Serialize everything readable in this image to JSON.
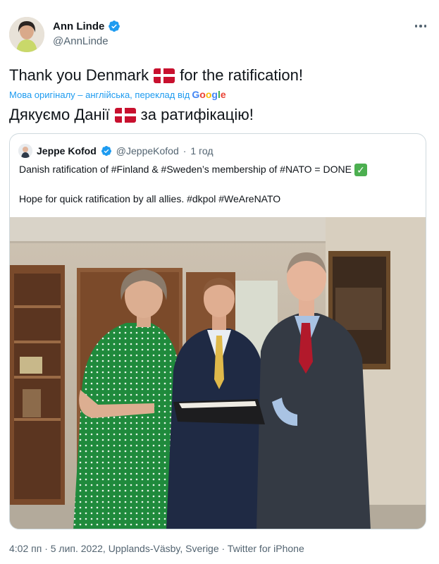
{
  "author": {
    "name": "Ann Linde",
    "handle": "@AnnLinde",
    "verified_icon": "verified-badge-icon"
  },
  "tweet": {
    "text_before": "Thank you Denmark",
    "text_after": "for the ratification!",
    "translation_note": "Мова оригіналу – англійська, переклад від",
    "translation_provider": [
      "G",
      "o",
      "o",
      "g",
      "l",
      "e"
    ],
    "translated_before": "Дякуємо Данії",
    "translated_after": "за ратифікацію!"
  },
  "quote": {
    "name": "Jeppe Kofod",
    "handle": "@JeppeKofod",
    "separator": "·",
    "time": "1 год",
    "line1": "Danish ratification of #Finland & #Sweden’s membership of #NATO = DONE",
    "line2": "Hope for quick ratification by all allies. #dkpol #WeAreNATO"
  },
  "footer": "4:02 пп · 5 лип. 2022, Upplands-Väsby, Sverige · Twitter for iPhone",
  "colors": {
    "accent": "#1d9bf0",
    "secondary_text": "#536471",
    "border": "#cfd9de",
    "flag_red": "#c8102e",
    "check_green": "#4caf50"
  }
}
